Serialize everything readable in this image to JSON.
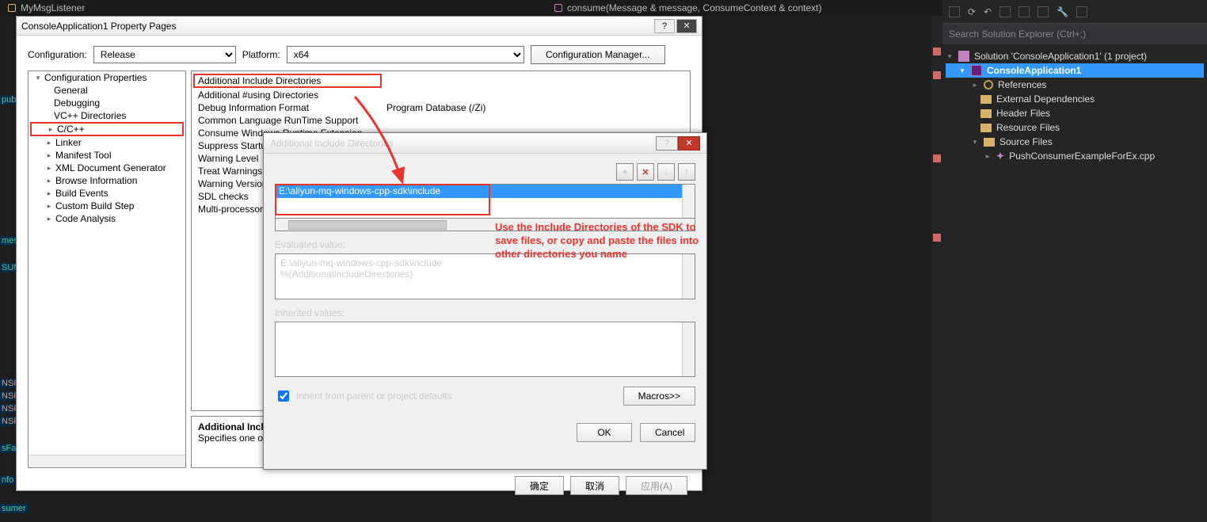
{
  "top_tabs": {
    "left": "MyMsgListener",
    "right": "consume(Message & message, ConsumeContext & context)"
  },
  "solution": {
    "search_placeholder": "Search Solution Explorer (Ctrl+;)",
    "root": "Solution 'ConsoleApplication1' (1 project)",
    "project": "ConsoleApplication1",
    "nodes": {
      "references": "References",
      "extdeps": "External Dependencies",
      "header": "Header Files",
      "resource": "Resource Files",
      "source": "Source Files",
      "cpp": "PushConsumerExampleForEx.cpp"
    }
  },
  "pp": {
    "title": "ConsoleApplication1 Property Pages",
    "cfg_label": "Configuration:",
    "cfg_value": "Release",
    "plat_label": "Platform:",
    "plat_value": "x64",
    "cfg_mgr": "Configuration Manager...",
    "tree": {
      "root": "Configuration Properties",
      "items": [
        "General",
        "Debugging",
        "VC++ Directories",
        "C/C++",
        "Linker",
        "Manifest Tool",
        "XML Document Generator",
        "Browse Information",
        "Build Events",
        "Custom Build Step",
        "Code Analysis"
      ]
    },
    "grid": {
      "r0k": "Additional Include Directories",
      "r0v": "",
      "r1k": "Additional #using Directories",
      "r1v": "",
      "r2k": "Debug Information Format",
      "r2v": "Program Database (/Zi)",
      "r3k": "Common Language RunTime Support",
      "r3v": "",
      "r4k": "Consume Windows Runtime Extension",
      "r4v": "",
      "r5k": "Suppress Startup Banner",
      "r5v": "",
      "r6k": "Warning Level",
      "r6v": "",
      "r7k": "Treat Warnings As Errors",
      "r7v": "",
      "r8k": "Warning Version",
      "r8v": "",
      "r9k": "SDL checks",
      "r9v": "",
      "r10k": "Multi-processor Compilation",
      "r10v": ""
    },
    "desc_title": "Additional Include Directories",
    "desc_body": "Specifies one or more directories to add to the include path; separate with semi-colons if more than one.     (/I[path])",
    "btn_ok": "确定",
    "btn_cancel": "取消",
    "btn_apply": "应用(A)"
  },
  "aid": {
    "title": "Additional Include Directories",
    "path": "E:\\aliyun-mq-windows-cpp-sdk\\include",
    "eval_label": "Evaluated value:",
    "eval1": "E:\\aliyun-mq-windows-cpp-sdk\\include",
    "eval2": "%(AdditionalIncludeDirectories)",
    "inh_label": "Inherited values:",
    "inherit_chk": "Inherit from parent or project defaults",
    "macros": "Macros>>",
    "ok": "OK",
    "cancel": "Cancel"
  },
  "anno": "Use the Include Directories of the SDK to save files, or copy and paste the files into other directories you name",
  "left_frags": {
    "a": "pub",
    "b": "mes",
    "c": "SUME",
    "d": "NSP",
    "e": "NSP",
    "f": "NSP",
    "g": "NSP",
    "h": "sFac",
    "i": "nfo",
    "j": "sumer"
  }
}
